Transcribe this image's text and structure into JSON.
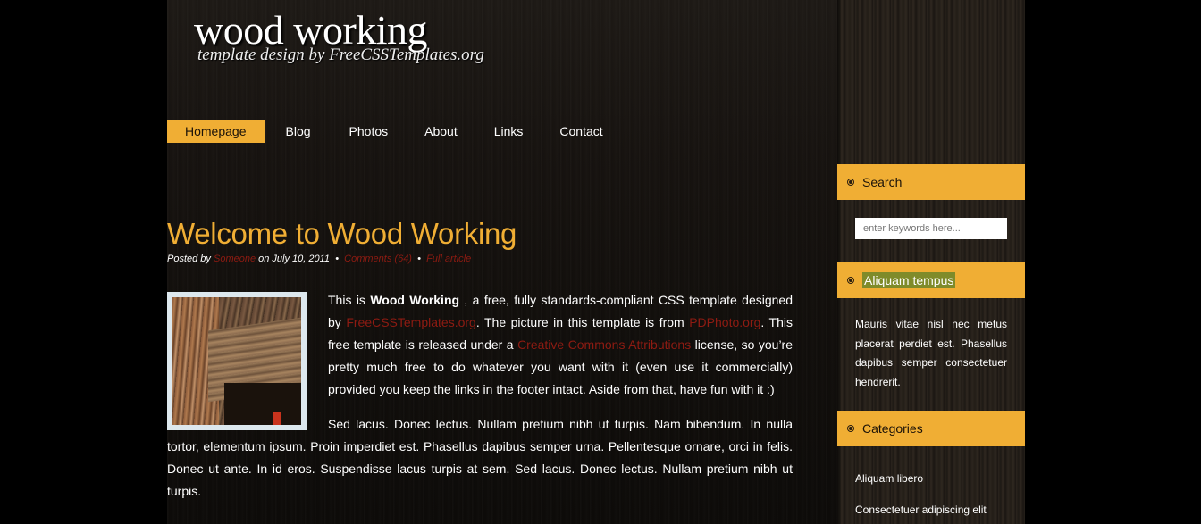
{
  "header": {
    "logo_title": "wood working",
    "logo_subtitle": "template design by FreeCSSTemplates.org"
  },
  "menu": {
    "items": [
      {
        "label": "Homepage",
        "active": true
      },
      {
        "label": "Blog"
      },
      {
        "label": "Photos"
      },
      {
        "label": "About"
      },
      {
        "label": "Links"
      },
      {
        "label": "Contact"
      }
    ]
  },
  "post": {
    "title": "Welcome to Wood Working",
    "meta": {
      "posted_by": "Posted by",
      "author": "Someone",
      "date_text": "on July 10, 2011",
      "sep": "•",
      "comments": "Comments (64)",
      "full_article": "Full article"
    },
    "p1": {
      "t1": "This is ",
      "strong": "Wood Working",
      "t2": " , a free, fully standards-compliant CSS template designed by ",
      "link1": "FreeCSSTemplates.org",
      "t3": ". The picture in this template is from ",
      "link2": "PDPhoto.org",
      "t4": ". This free template is released under a ",
      "link3": "Creative Commons Attributions",
      "t5": " license, so you’re pretty much free to do whatever you want with it (even use it commercially) provided you keep the links in the footer intact. Aside from that, have fun with it :)"
    },
    "p2": "Sed lacus. Donec lectus. Nullam pretium nibh ut turpis. Nam bibendum. In nulla tortor, elementum ipsum. Proin imperdiet est. Phasellus dapibus semper urna. Pellentesque ornare, orci in felis. Donec ut ante. In id eros. Suspendisse lacus turpis at sem. Sed lacus. Donec lectus. Nullam pretium nibh ut turpis."
  },
  "sidebar": {
    "search": {
      "heading": "Search",
      "placeholder": "enter keywords here..."
    },
    "box2": {
      "heading": "Aliquam tempus",
      "text": "Mauris vitae nisl nec metus placerat perdiet est. Phasellus dapibus semper consectetuer hendrerit."
    },
    "categories": {
      "heading": "Categories",
      "items": [
        "Aliquam libero",
        "Consectetuer adipiscing elit"
      ]
    }
  },
  "colors": {
    "accent": "#f0ae34",
    "link": "#8e1b12",
    "highlight": "#7f8b2a"
  }
}
